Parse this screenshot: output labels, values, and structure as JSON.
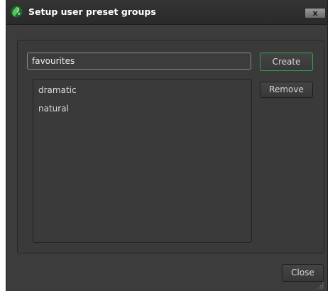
{
  "window": {
    "title": "Setup user preset groups",
    "close_glyph": "x"
  },
  "form": {
    "group_name_value": "favourites",
    "create_label": "Create",
    "remove_label": "Remove",
    "close_label": "Close"
  },
  "groups": {
    "items": [
      "dramatic",
      "natural"
    ]
  },
  "icons": {
    "app": "app-logo-icon",
    "close": "close-icon",
    "resize": "resize-grip-icon"
  },
  "colors": {
    "window_bg": "#3c3c3c",
    "title_bg": "#2e2e2e",
    "accent_green": "#2f9e4a",
    "text": "#dcdcdc"
  }
}
